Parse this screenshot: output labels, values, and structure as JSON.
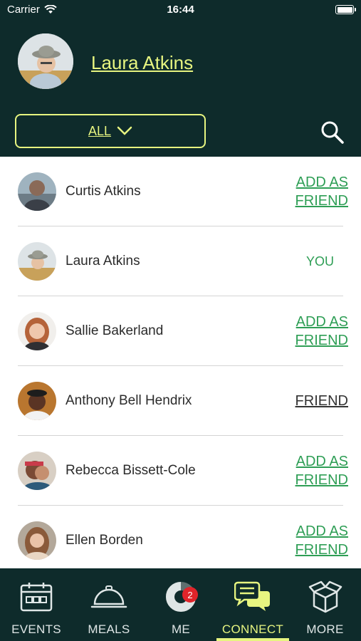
{
  "status_bar": {
    "carrier": "Carrier",
    "time": "16:44"
  },
  "profile": {
    "name": "Laura Atkins"
  },
  "filter": {
    "label": "ALL"
  },
  "people": [
    {
      "name": "Curtis Atkins",
      "action": "ADD AS FRIEND",
      "action_lines": [
        "ADD AS",
        "FRIEND"
      ],
      "status": "add"
    },
    {
      "name": "Laura Atkins",
      "action": "YOU",
      "action_lines": [
        "YOU"
      ],
      "status": "self"
    },
    {
      "name": "Sallie Bakerland",
      "action": "ADD AS FRIEND",
      "action_lines": [
        "ADD AS",
        "FRIEND"
      ],
      "status": "add"
    },
    {
      "name": "Anthony Bell Hendrix",
      "action": "FRIEND",
      "action_lines": [
        "FRIEND"
      ],
      "status": "friend"
    },
    {
      "name": "Rebecca Bissett-Cole",
      "action": "ADD AS FRIEND",
      "action_lines": [
        "ADD AS",
        "FRIEND"
      ],
      "status": "add"
    },
    {
      "name": "Ellen Borden",
      "action": "ADD AS FRIEND",
      "action_lines": [
        "ADD AS",
        "FRIEND"
      ],
      "status": "add"
    }
  ],
  "tabs": [
    {
      "label": "EVENTS",
      "icon": "calendar-icon"
    },
    {
      "label": "MEALS",
      "icon": "cloche-icon"
    },
    {
      "label": "ME",
      "icon": "progress-ring-icon",
      "badge": "2"
    },
    {
      "label": "CONNECT",
      "icon": "chat-bubbles-icon",
      "active": true
    },
    {
      "label": "MORE",
      "icon": "box-icon"
    }
  ],
  "colors": {
    "header_bg": "#0e2b2b",
    "accent": "#e7f580",
    "link_green": "#2e9e55",
    "badge_red": "#e0242a"
  }
}
